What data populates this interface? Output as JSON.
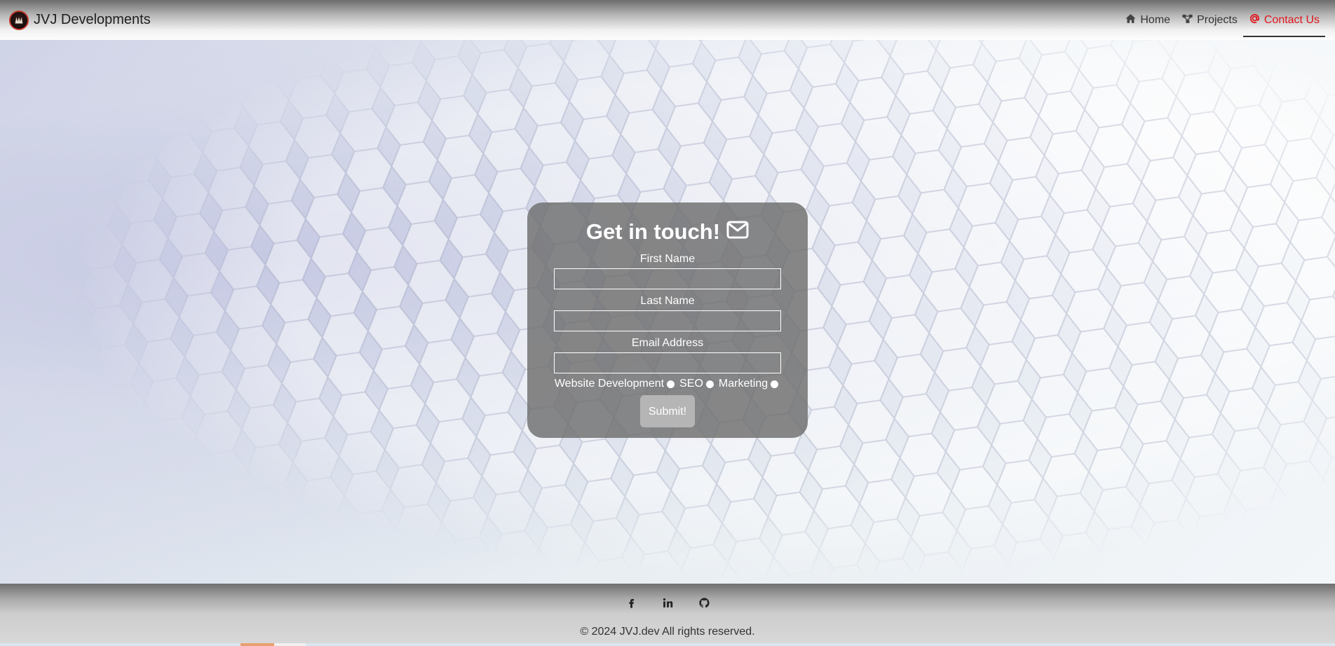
{
  "brand": {
    "name": "JVJ Developments",
    "logo_icon": "jvj-logo-icon"
  },
  "nav": {
    "items": [
      {
        "label": "Home",
        "icon": "home-icon",
        "active": false
      },
      {
        "label": "Projects",
        "icon": "projects-icon",
        "active": false
      },
      {
        "label": "Contact Us",
        "icon": "at-icon",
        "active": true
      }
    ],
    "active_color": "#e0161e"
  },
  "contact": {
    "title": "Get in touch!",
    "title_icon": "envelope-icon",
    "first_name_label": "First Name",
    "first_name_value": "",
    "last_name_label": "Last Name",
    "last_name_value": "",
    "email_label": "Email Address",
    "email_value": "",
    "services": [
      "Website Development",
      "SEO",
      "Marketing"
    ],
    "submit_label": "Submit!"
  },
  "footer": {
    "social": [
      "facebook-icon",
      "linkedin-icon",
      "github-icon"
    ],
    "copyright": "© 2024 JVJ.dev All rights reserved."
  }
}
